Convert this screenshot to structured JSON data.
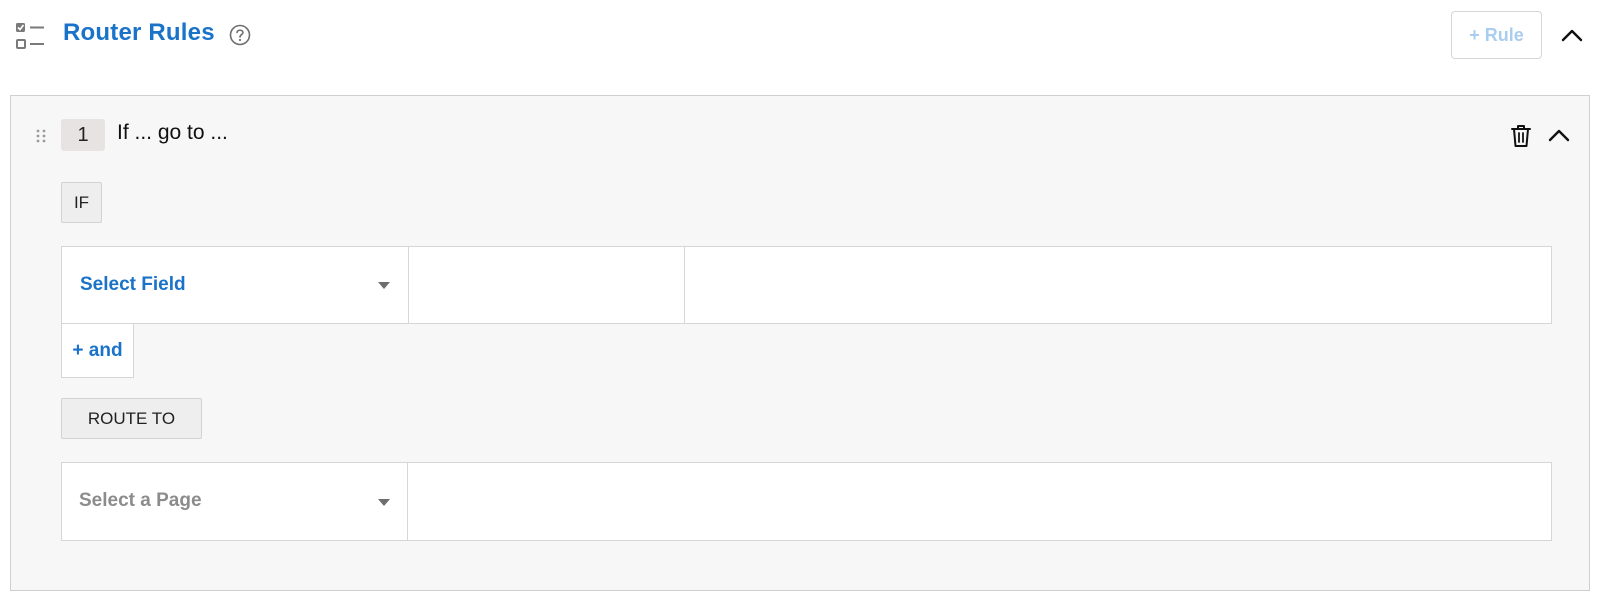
{
  "header": {
    "title": "Router Rules",
    "add_rule_label": "+ Rule"
  },
  "rule": {
    "number": "1",
    "summary": "If ... go to ...",
    "if_label": "IF",
    "condition": {
      "field_placeholder": "Select Field",
      "operator": "",
      "value": ""
    },
    "and_label": "+ and",
    "route_to_label": "ROUTE TO",
    "route": {
      "page_placeholder": "Select a Page"
    }
  },
  "colors": {
    "accent": "#1a73c9",
    "disabled_accent": "#a9cdee",
    "card_background": "#f7f7f7",
    "border": "#d6d6d6",
    "muted_text": "#8c8c8c"
  },
  "icons": [
    "checklist-icon",
    "help-circle-icon",
    "chevron-up-icon",
    "drag-handle-icon",
    "trash-icon",
    "caret-down-icon"
  ]
}
